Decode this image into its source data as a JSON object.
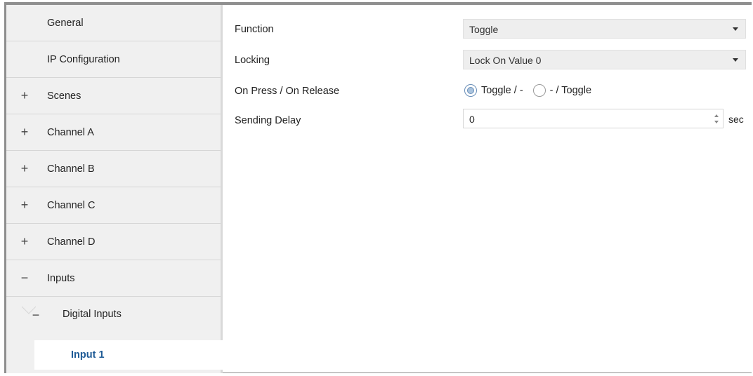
{
  "sidebar": {
    "items": [
      {
        "label": "General",
        "expander": ""
      },
      {
        "label": "IP Configuration",
        "expander": ""
      },
      {
        "label": "Scenes",
        "expander": "+"
      },
      {
        "label": "Channel A",
        "expander": "+"
      },
      {
        "label": "Channel B",
        "expander": "+"
      },
      {
        "label": "Channel C",
        "expander": "+"
      },
      {
        "label": "Channel D",
        "expander": "+"
      },
      {
        "label": "Inputs",
        "expander": "−"
      },
      {
        "label": "Digital Inputs",
        "expander": "−"
      },
      {
        "label": "Input 1",
        "expander": ""
      }
    ],
    "selected": "Input 1"
  },
  "form": {
    "function": {
      "label": "Function",
      "value": "Toggle"
    },
    "locking": {
      "label": "Locking",
      "value": "Lock On Value 0"
    },
    "press_release": {
      "label": "On Press / On Release",
      "options": [
        "Toggle / -",
        "- / Toggle"
      ],
      "selected": "Toggle / -"
    },
    "sending_delay": {
      "label": "Sending Delay",
      "value": "0",
      "unit": "sec"
    }
  },
  "colors": {
    "sidebar_bg": "#f0f0f0",
    "selected_text": "#1f5b96",
    "select_bg": "#eeeeee"
  },
  "icons": {
    "expand": "plus-icon",
    "collapse": "minus-icon",
    "dropdown": "caret-down-icon",
    "spinner": "spin-arrows-icon"
  }
}
